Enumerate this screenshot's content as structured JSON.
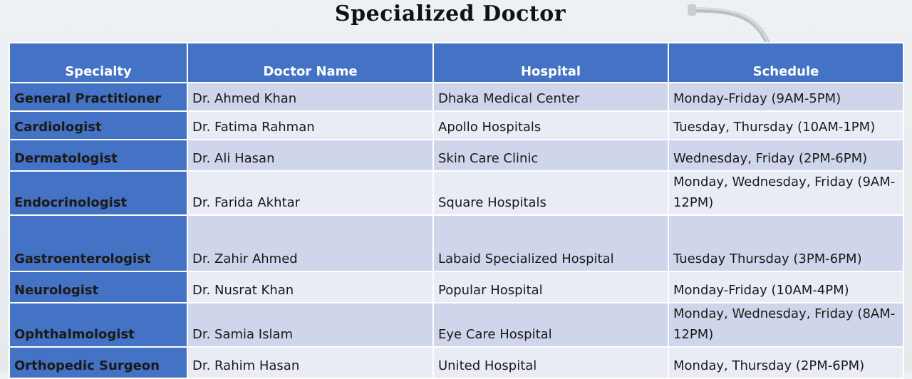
{
  "title": "Specialized Doctor",
  "colors": {
    "header_bg": "#4472c4",
    "row_odd": "#cfd5ea",
    "row_even": "#e9ebf5"
  },
  "columns": [
    "Specialty",
    "Doctor Name",
    "Hospital",
    "Schedule"
  ],
  "rows": [
    {
      "specialty": "General Practitioner",
      "doctor": "Dr. Ahmed Khan",
      "hospital": "Dhaka Medical Center",
      "schedule": "Monday-Friday (9AM-5PM)"
    },
    {
      "specialty": "Cardiologist",
      "doctor": "Dr. Fatima Rahman",
      "hospital": "Apollo Hospitals",
      "schedule": "Tuesday, Thursday (10AM-1PM)"
    },
    {
      "specialty": "Dermatologist",
      "doctor": "Dr. Ali Hasan",
      "hospital": "Skin Care Clinic",
      "schedule": "Wednesday, Friday (2PM-6PM)"
    },
    {
      "specialty": "Endocrinologist",
      "doctor": "Dr. Farida Akhtar",
      "hospital": "Square Hospitals",
      "schedule": "Monday, Wednesday, Friday (9AM-12PM)"
    },
    {
      "specialty": "Gastroenterologist",
      "doctor": "Dr. Zahir Ahmed",
      "hospital": "Labaid Specialized Hospital",
      "schedule": "Tuesday Thursday (3PM-6PM)"
    },
    {
      "specialty": "Neurologist",
      "doctor": "Dr. Nusrat Khan",
      "hospital": "Popular Hospital",
      "schedule": "Monday-Friday (10AM-4PM)"
    },
    {
      "specialty": "Ophthalmologist",
      "doctor": "Dr. Samia Islam",
      "hospital": "Eye Care Hospital",
      "schedule": "Monday, Wednesday, Friday (8AM-12PM)"
    },
    {
      "specialty": "Orthopedic Surgeon",
      "doctor": "Dr. Rahim Hasan",
      "hospital": "United Hospital",
      "schedule": "Monday, Thursday (2PM-6PM)"
    }
  ]
}
